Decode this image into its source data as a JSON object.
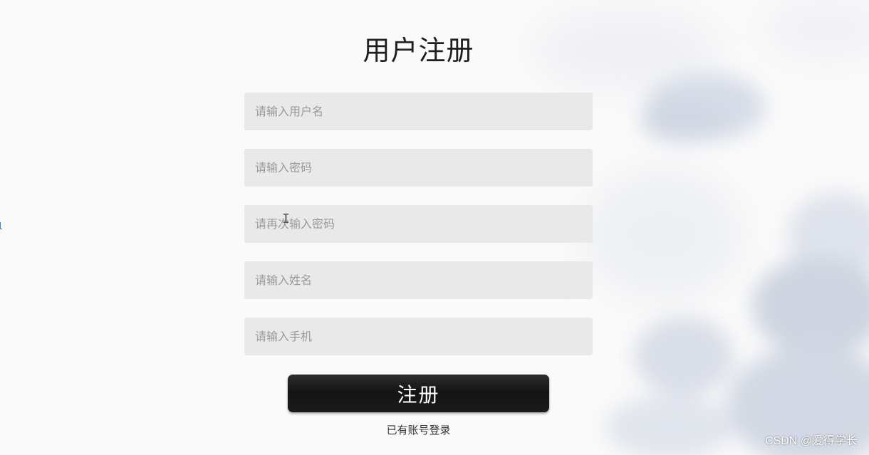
{
  "page": {
    "title": "用户注册"
  },
  "form": {
    "username": {
      "placeholder": "请输入用户名",
      "value": ""
    },
    "password": {
      "placeholder": "请输入密码",
      "value": ""
    },
    "confirm_password": {
      "placeholder": "请再次输入密码",
      "value": ""
    },
    "name": {
      "placeholder": "请输入姓名",
      "value": ""
    },
    "phone": {
      "placeholder": "请输入手机",
      "value": ""
    },
    "submit_label": "注册",
    "login_link": "已有账号登录"
  },
  "watermark": "CSDN @爱得学长",
  "colors": {
    "background": "#fafafa",
    "field_background": "#e9e9e9",
    "button_background": "#1b1b1b",
    "button_text": "#ffffff",
    "placeholder_text": "#9a9a9a",
    "cloud": "#d4dae6"
  }
}
